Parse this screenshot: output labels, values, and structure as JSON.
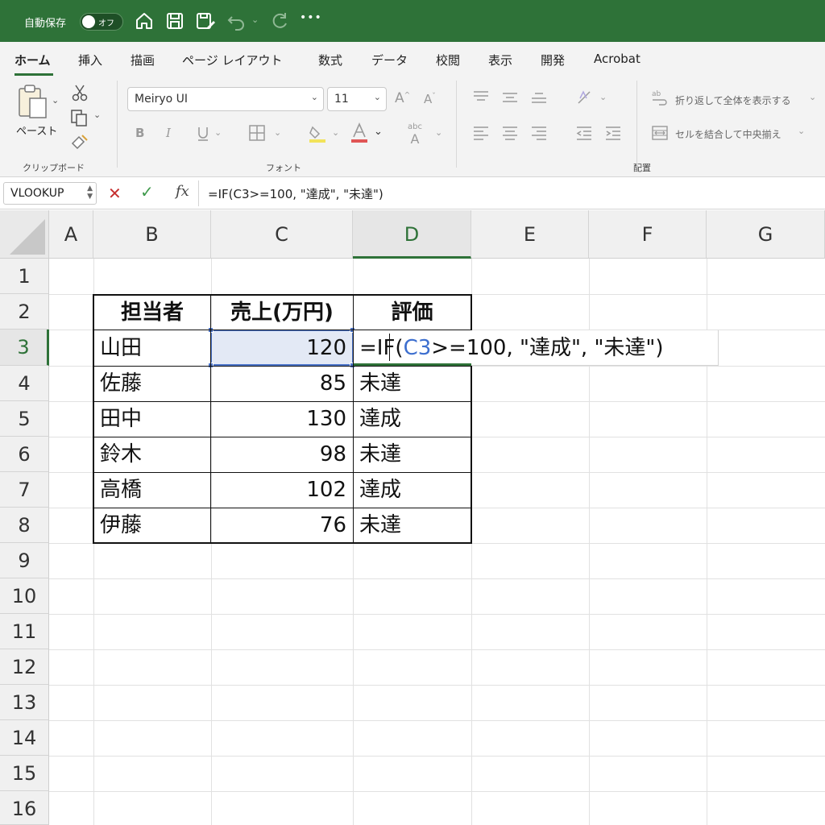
{
  "titlebar": {
    "autosave_label": "自動保存",
    "toggle_label": "オフ",
    "more_label": "•••"
  },
  "tabs": [
    "ホーム",
    "挿入",
    "描画",
    "ページ レイアウト",
    "数式",
    "データ",
    "校閲",
    "表示",
    "開発",
    "Acrobat"
  ],
  "ribbon": {
    "paste_label": "ペースト",
    "clipboard_group": "クリップボード",
    "font_name": "Meiryo UI",
    "font_size": "11",
    "font_group": "フォント",
    "bold": "B",
    "italic": "I",
    "wrap_text": "折り返して全体を表示する",
    "merge_center": "セルを結合して中央揃え",
    "alignment_group": "配置",
    "colors": {
      "accent": "#2e7238",
      "font_color": "#e05555",
      "fill_color": "#f2e35a"
    }
  },
  "formula_bar": {
    "name_box": "VLOOKUP",
    "cancel": "✕",
    "enter": "✓",
    "fx": "fx",
    "content": "=IF(C3>=100, \"達成\", \"未達\")"
  },
  "sheet": {
    "columns": [
      "A",
      "B",
      "C",
      "D",
      "E",
      "F",
      "G"
    ],
    "rows": [
      "1",
      "2",
      "3",
      "4",
      "5",
      "6",
      "7",
      "8",
      "9",
      "10",
      "11",
      "12",
      "13",
      "14",
      "15",
      "16"
    ],
    "table_headers": [
      "担当者",
      "売上(万円)",
      "評価"
    ],
    "table_rows": [
      {
        "name": "山田",
        "sales": "120",
        "eval": ""
      },
      {
        "name": "佐藤",
        "sales": "85",
        "eval": "未達"
      },
      {
        "name": "田中",
        "sales": "130",
        "eval": "達成"
      },
      {
        "name": "鈴木",
        "sales": "98",
        "eval": "未達"
      },
      {
        "name": "高橋",
        "sales": "102",
        "eval": "達成"
      },
      {
        "name": "伊藤",
        "sales": "76",
        "eval": "未達"
      }
    ],
    "editing": {
      "prefix": "=IF(",
      "ref": "C3",
      "suffix": ">=100, \"達成\", \"未達\")"
    }
  }
}
